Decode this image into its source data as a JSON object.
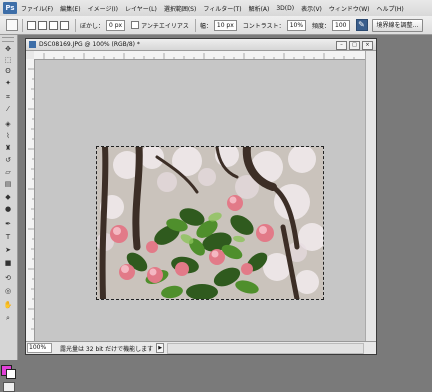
{
  "app": {
    "logo": "Ps"
  },
  "menubar": {
    "items": [
      "ファイル(F)",
      "編集(E)",
      "イメージ(I)",
      "レイヤー(L)",
      "選択範囲(S)",
      "フィルター(T)",
      "解析(A)",
      "3D(D)",
      "表示(V)",
      "ウィンドウ(W)",
      "ヘルプ(H)"
    ]
  },
  "options_bar": {
    "feather_label": "ぼかし：",
    "feather_value": "0 px",
    "antialias_label": "アンチエイリアス",
    "width_label": "幅：",
    "width_value": "10 px",
    "contrast_label": "コントラスト：",
    "contrast_value": "10%",
    "frequency_label": "頻度：",
    "frequency_value": "100",
    "refine_edge_label": "境界線を調整..."
  },
  "document": {
    "title": "DSC08169.JPG @ 100% (RGB/8) *",
    "zoom": "100%",
    "status": "露光量は 32 bit だけで機能します",
    "status_arrow": "▶"
  },
  "colors": {
    "foreground": "#e040d8",
    "background": "#ffffff",
    "accent": "#3d6ea8"
  },
  "icons": {
    "tools": [
      "move-icon",
      "marquee-icon",
      "lasso-icon",
      "magic-wand-icon",
      "crop-icon",
      "eyedropper-icon",
      "healing-brush-icon",
      "brush-icon",
      "clone-stamp-icon",
      "history-brush-icon",
      "eraser-icon",
      "gradient-icon",
      "blur-icon",
      "dodge-icon",
      "pen-icon",
      "type-icon",
      "path-selection-icon",
      "shape-icon",
      "3d-rotate-icon",
      "3d-orbit-icon",
      "hand-icon",
      "zoom-icon"
    ]
  }
}
